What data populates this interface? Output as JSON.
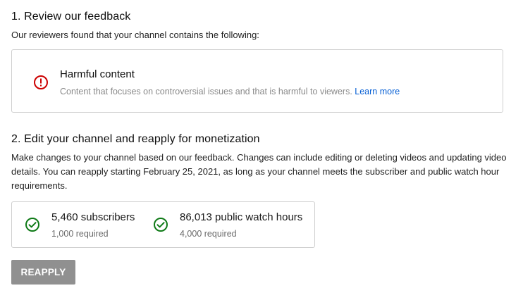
{
  "review": {
    "title": "1. Review our feedback",
    "description": "Our reviewers found that your channel contains the following:",
    "issue": {
      "icon": "alert-circle-icon",
      "title": "Harmful content",
      "text": "Content that focuses on controversial issues and that is harmful to viewers.",
      "link_label": "Learn more"
    }
  },
  "edit": {
    "title": "2. Edit your channel and reapply for monetization",
    "description": "Make changes to your channel based on our feedback. Changes can include editing or deleting videos and updating video details. You can reapply starting February 25, 2021, as long as your channel meets the subscriber and public watch hour requirements."
  },
  "requirements": [
    {
      "value": "5,460 subscribers",
      "required": "1,000 required",
      "icon": "check-circle-icon"
    },
    {
      "value": "86,013 public watch hours",
      "required": "4,000 required",
      "icon": "check-circle-icon"
    }
  ],
  "actions": {
    "reapply_label": "REAPPLY"
  },
  "colors": {
    "alert": "#cc0000",
    "success": "#0f7a17",
    "link": "#065fd4",
    "button_disabled": "#909090"
  }
}
